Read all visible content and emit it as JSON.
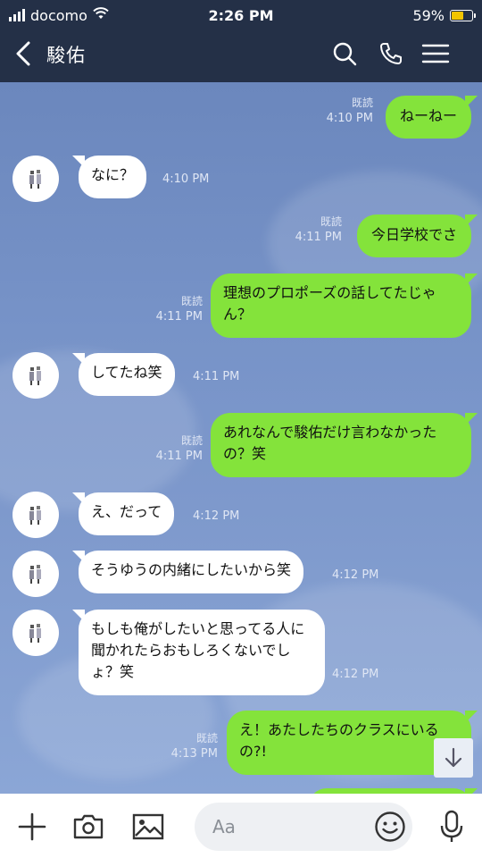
{
  "status_bar": {
    "carrier": "docomo",
    "time": "2:26 PM",
    "battery": "59%",
    "battery_level": 0.59
  },
  "header": {
    "title": "駿佑"
  },
  "messages": [
    {
      "side": "me",
      "text": "ねーねー",
      "read": "既読",
      "time": "4:10 PM"
    },
    {
      "side": "them",
      "text": "なに？",
      "time": "4:10 PM"
    },
    {
      "side": "me",
      "text": "今日学校でさ",
      "read": "既読",
      "time": "4:11 PM"
    },
    {
      "side": "me",
      "text": "理想のプロポーズの話してたじゃん？",
      "read": "既読",
      "time": "4:11 PM"
    },
    {
      "side": "them",
      "text": "してたね笑",
      "time": "4:11 PM"
    },
    {
      "side": "me",
      "text": "あれなんで駿佑だけ言わなかったの？笑",
      "read": "既読",
      "time": "4:11 PM"
    },
    {
      "side": "them",
      "text": "え、だって",
      "time": "4:12 PM"
    },
    {
      "side": "them",
      "text": "そうゆうの内緒にしたいから笑",
      "time": "4:12 PM"
    },
    {
      "side": "them",
      "text": "もしも俺がしたいと思ってる人に聞かれたらおもしろくないでしょ？笑",
      "time": "4:12 PM"
    },
    {
      "side": "me",
      "text": "え！あたしたちのクラスにいるの?!",
      "read": "既読",
      "time": "4:13 PM"
    }
  ],
  "composer": {
    "placeholder": "Aa"
  },
  "icons": {
    "back": "chevron-left-icon",
    "search": "search-icon",
    "call": "phone-icon",
    "menu": "hamburger-menu-icon",
    "add": "plus-icon",
    "camera": "camera-icon",
    "image": "image-icon",
    "emoji": "smiley-icon",
    "mic": "microphone-icon",
    "scroll": "arrow-down-icon"
  },
  "colors": {
    "header_bg": "#243047",
    "chat_bg": "#7793c8",
    "my_bubble": "#84e33b",
    "their_bubble": "#ffffff"
  }
}
